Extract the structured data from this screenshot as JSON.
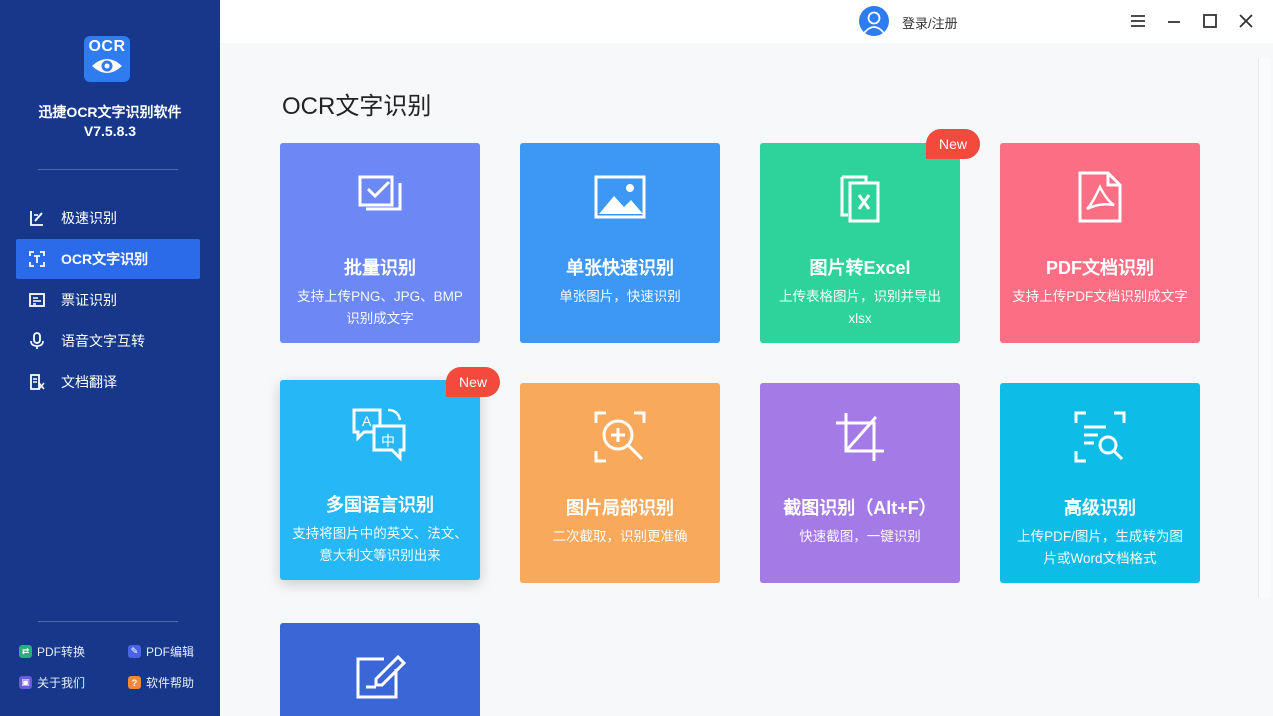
{
  "app": {
    "logo_text": "OCR",
    "name": "迅捷OCR文字识别软件",
    "version": "V7.5.8.3"
  },
  "sidebar": {
    "items": [
      {
        "label": "极速识别",
        "icon": "fast-recognize-icon",
        "active": false
      },
      {
        "label": "OCR文字识别",
        "icon": "ocr-scan-icon",
        "active": true
      },
      {
        "label": "票证识别",
        "icon": "ticket-icon",
        "active": false
      },
      {
        "label": "语音文字互转",
        "icon": "microphone-icon",
        "active": false
      },
      {
        "label": "文档翻译",
        "icon": "translate-document-icon",
        "active": false
      }
    ],
    "bottom_links": [
      {
        "label": "PDF转换",
        "icon": "pdf-convert-icon",
        "color": "#27b07a"
      },
      {
        "label": "PDF编辑",
        "icon": "pdf-edit-icon",
        "color": "#4a63e6"
      },
      {
        "label": "关于我们",
        "icon": "about-icon",
        "color": "#6b5ae0"
      },
      {
        "label": "软件帮助",
        "icon": "help-icon",
        "color": "#f08a3a"
      }
    ]
  },
  "topbar": {
    "login_label": "登录/注册"
  },
  "main": {
    "title": "OCR文字识别",
    "badge_text": "New",
    "cards": [
      {
        "title": "批量识别",
        "desc": "支持上传PNG、JPG、BMP识别成文字",
        "color": "#6b88f5",
        "icon": "batch-check-icon"
      },
      {
        "title": "单张快速识别",
        "desc": "单张图片，快速识别",
        "color": "#3d97f5",
        "icon": "image-icon"
      },
      {
        "title": "图片转Excel",
        "desc": "上传表格图片，识别并导出xlsx",
        "color": "#2dd39a",
        "icon": "excel-icon",
        "badge": true
      },
      {
        "title": "PDF文档识别",
        "desc": "支持上传PDF文档识别成文字",
        "color": "#fb6e83",
        "icon": "pdf-icon"
      },
      {
        "title": "多国语言识别",
        "desc": "支持将图片中的英文、法文、意大利文等识别出来",
        "color": "#26b7f7",
        "icon": "language-icon",
        "badge": true
      },
      {
        "title": "图片局部识别",
        "desc": "二次截取，识别更准确",
        "color": "#f8a95c",
        "icon": "zoom-in-icon"
      },
      {
        "title": "截图识别（Alt+F）",
        "desc": "快速截图，一键识别",
        "color": "#a47ae6",
        "icon": "crop-icon"
      },
      {
        "title": "高级识别",
        "desc": "上传PDF/图片，生成转为图片或Word文档格式",
        "color": "#0dbde8",
        "icon": "advanced-scan-icon"
      },
      {
        "title": "",
        "desc": "",
        "color": "#3a66d6",
        "icon": "edit-icon"
      }
    ]
  }
}
